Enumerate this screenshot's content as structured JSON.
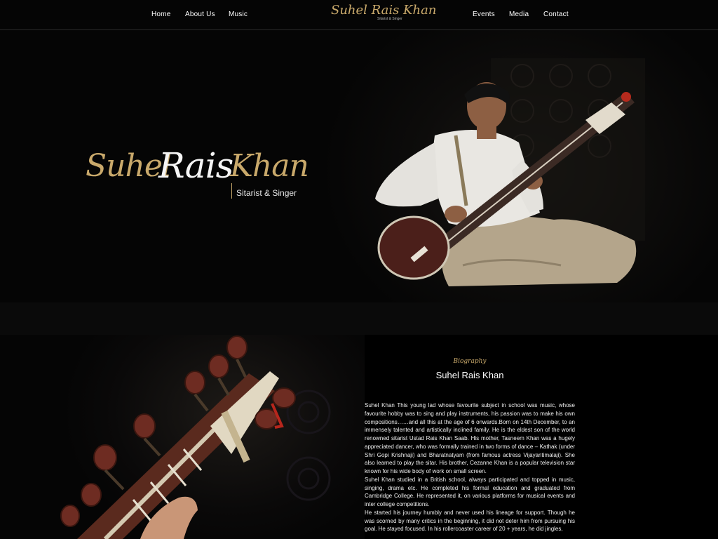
{
  "nav": {
    "left_items": [
      "Home",
      "About Us",
      "Music"
    ],
    "right_items": [
      "Events",
      "Media",
      "Contact"
    ],
    "logo": {
      "script": "Suhel Rais Khan",
      "sub": "Sitarist & Singer"
    }
  },
  "hero": {
    "logo_first": "Suhel",
    "logo_middle": "Rais",
    "logo_last": "Khan",
    "tagline": "Sitarist & Singer"
  },
  "biography": {
    "kicker": "Biography",
    "title": "Suhel Rais Khan",
    "paragraphs": [
      "Suhel Khan This young lad whose favourite subject in school was music, whose favourite hobby was to sing and play instruments, his passion was to make his own compositions……and all this at the age of 6 onwards.Born on 14th December, to an immensely talented and artistically inclined family. He is the eldest son of the world renowned sitarist Ustad Rais Khan Saab. His mother, Tasneem Khan was a hugely appreciated dancer, who was formally trained in two forms of dance – Kathak (under Shri Gopi Krishnaji) and Bharatnatyam (from famous actress Vijayantimalaji). She also learned to play the sitar. His brother, Cezanne Khan is a popular television star known for his wide body of work on small screen.",
      "Suhel Khan studied in a British school, always participated and topped in music, singing, drama etc. He completed his formal education and graduated from Cambridge College. He represented it, on various platforms for musical events and inter college competitions.",
      "He started his journey humbly and never used his lineage for support. Though he was scorned by many critics in the beginning, it did not deter him from pursuing his goal. He stayed focused. In his rollercoaster career of 20 + years, he did jingles,"
    ]
  },
  "colors": {
    "accent_gold": "#c9a96b",
    "background": "#000000"
  }
}
